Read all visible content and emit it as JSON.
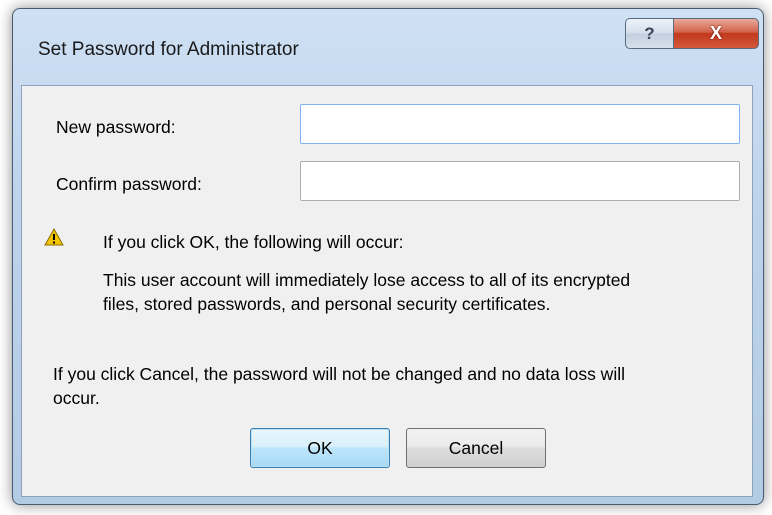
{
  "window": {
    "title": "Set Password for Administrator",
    "help_glyph": "?",
    "close_glyph": "X"
  },
  "form": {
    "new_password_label": "New password:",
    "new_password_value": "",
    "confirm_password_label": "Confirm password:",
    "confirm_password_value": ""
  },
  "warning": {
    "icon": "warning-icon",
    "heading": "If you click OK, the following will occur:",
    "detail_line1": "This user account will immediately lose access to all of its encrypted",
    "detail_line2": "files, stored passwords, and personal security certificates."
  },
  "cancel_info": {
    "line1": "If you click Cancel, the password will not be changed and no data loss will",
    "line2": "occur."
  },
  "buttons": {
    "ok_label": "OK",
    "cancel_label": "Cancel"
  },
  "colors": {
    "accent": "#3c7fb1",
    "close_red": "#c2391d",
    "warning_yellow": "#f5c400"
  }
}
